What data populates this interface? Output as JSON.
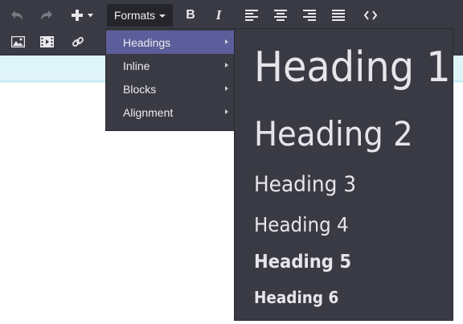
{
  "toolbar": {
    "row1": [
      {
        "name": "undo-icon",
        "disabled": true
      },
      {
        "name": "redo-icon",
        "disabled": true
      },
      {
        "name": "insert-plus-icon",
        "disabled": false
      },
      {
        "name": "bold-icon",
        "disabled": false
      },
      {
        "name": "italic-icon",
        "disabled": false
      },
      {
        "name": "align-left-icon",
        "disabled": false
      },
      {
        "name": "align-center-icon",
        "disabled": false
      },
      {
        "name": "align-right-icon",
        "disabled": false
      },
      {
        "name": "align-justify-icon",
        "disabled": false
      },
      {
        "name": "code-icon",
        "disabled": false
      }
    ],
    "row2": [
      {
        "name": "image-icon"
      },
      {
        "name": "media-icon"
      },
      {
        "name": "link-icon"
      }
    ],
    "formats_label": "Formats",
    "bold_label": "B",
    "italic_label": "I",
    "background": "#3a3a44"
  },
  "formats_menu": {
    "items": [
      {
        "label": "Headings",
        "active": true
      },
      {
        "label": "Inline",
        "active": false
      },
      {
        "label": "Blocks",
        "active": false
      },
      {
        "label": "Alignment",
        "active": false
      }
    ],
    "active_color": "#5b5e9a"
  },
  "headings_submenu": {
    "items": [
      {
        "label": "Heading 1"
      },
      {
        "label": "Heading 2"
      },
      {
        "label": "Heading 3"
      },
      {
        "label": "Heading 4"
      },
      {
        "label": "Heading 5"
      },
      {
        "label": "Heading 6"
      }
    ]
  }
}
